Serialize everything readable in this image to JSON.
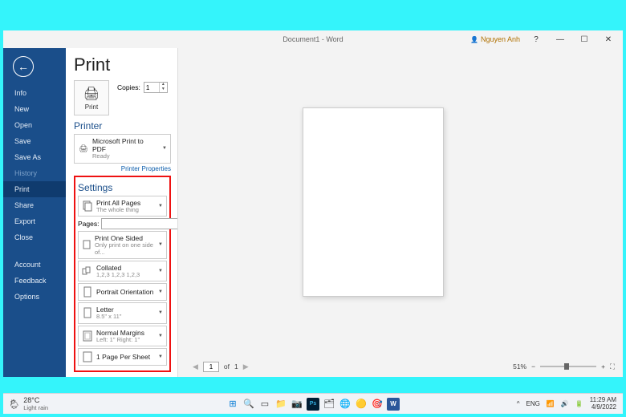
{
  "window": {
    "title": "Document1 - Word",
    "user": "Nguyen Anh"
  },
  "sidebar": {
    "items": [
      {
        "label": "Info"
      },
      {
        "label": "New"
      },
      {
        "label": "Open"
      },
      {
        "label": "Save"
      },
      {
        "label": "Save As"
      },
      {
        "label": "History"
      },
      {
        "label": "Print"
      },
      {
        "label": "Share"
      },
      {
        "label": "Export"
      },
      {
        "label": "Close"
      },
      {
        "label": "Account"
      },
      {
        "label": "Feedback"
      },
      {
        "label": "Options"
      }
    ],
    "active_index": 6,
    "faded_index": 5
  },
  "print": {
    "heading": "Print",
    "button_label": "Print",
    "copies_label": "Copies:",
    "copies_value": "1",
    "printer_heading": "Printer",
    "printer_name": "Microsoft Print to PDF",
    "printer_status": "Ready",
    "printer_props_link": "Printer Properties",
    "settings_heading": "Settings",
    "pages_label": "Pages:",
    "pages_value": "",
    "settings": [
      {
        "title": "Print All Pages",
        "sub": "The whole thing",
        "icon": "pages"
      },
      {
        "title": "Print One Sided",
        "sub": "Only print on one side of...",
        "icon": "side"
      },
      {
        "title": "Collated",
        "sub": "1,2,3   1,2,3   1,2,3",
        "icon": "collate"
      },
      {
        "title": "Portrait Orientation",
        "sub": "",
        "icon": "portrait"
      },
      {
        "title": "Letter",
        "sub": "8.5\" x 11\"",
        "icon": "size"
      },
      {
        "title": "Normal Margins",
        "sub": "Left: 1\"   Right: 1\"",
        "icon": "margins"
      },
      {
        "title": "1 Page Per Sheet",
        "sub": "",
        "icon": "persheet"
      }
    ]
  },
  "preview": {
    "page_current": "1",
    "page_total": "1",
    "page_of": "of",
    "zoom_pct": "51%"
  },
  "taskbar": {
    "temp": "28°C",
    "weather": "Light rain",
    "lang": "ENG",
    "time": "11:29 AM",
    "date": "4/9/2022"
  }
}
